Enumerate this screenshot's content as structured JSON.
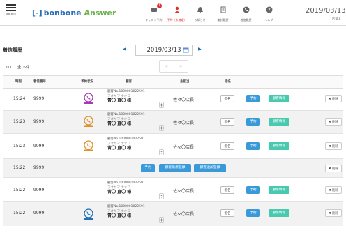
{
  "header": {
    "menu_label": "MENU",
    "logo_bracket": "[-]",
    "logo_brand": "bonbone",
    "logo_answer": "Answer",
    "nav": [
      {
        "label": "キャスト予約",
        "icon": "cast-icon",
        "badge": "1",
        "highlight": false
      },
      {
        "label": "予約（未確定）",
        "icon": "person-icon",
        "badge": "",
        "highlight": true
      },
      {
        "label": "お知らせ",
        "icon": "bell-icon",
        "badge": "",
        "highlight": false
      },
      {
        "label": "集計履歴",
        "icon": "doc-icon",
        "badge": "",
        "highlight": false
      },
      {
        "label": "着信履歴",
        "icon": "phone-icon",
        "badge": "",
        "highlight": false
      },
      {
        "label": "ヘルプ",
        "icon": "help-icon",
        "badge": "",
        "highlight": false
      }
    ],
    "date": "2019/03/13",
    "sub": "店舗1"
  },
  "page": {
    "title": "着信履歴",
    "date": "2019/03/13",
    "prev": "◀",
    "next": "▶",
    "page_info": "1/1",
    "total_label": "全",
    "total": "6件",
    "pager_prev": "«",
    "pager_next": "»"
  },
  "columns": [
    "時刻",
    "着信番号",
    "予約状況",
    "顧客",
    "主担当",
    "指名"
  ],
  "actions": {
    "nominate": "指名",
    "reserve": "予約",
    "customer_info": "顧客情報",
    "delete": "✖ 削除",
    "new_customer": "顧客新規登録",
    "add_customer": "顧客追加登録"
  },
  "rows": [
    {
      "type": "full",
      "time": "15:24",
      "number": "9999",
      "status_color": "#a63cb5",
      "cust_no": "顧客No.1000001022591",
      "cust_kana": "アオヤマ ナオコ",
      "cust_name": "青〇 直〇 様",
      "staff": "佐々〇店長"
    },
    {
      "type": "full",
      "time": "15:23",
      "number": "9999",
      "status_color": "#e0902a",
      "cust_no": "顧客No.1000001022591",
      "cust_kana": "アオヤマ ナオコ",
      "cust_name": "青〇 直〇 様",
      "staff": "佐々〇店長"
    },
    {
      "type": "full",
      "time": "15:23",
      "number": "9999",
      "status_color": "#e0902a",
      "cust_no": "顧客No.1000001022591",
      "cust_kana": "アオヤマ ナオコ",
      "cust_name": "青〇 直〇 様",
      "staff": "佐々〇店長"
    },
    {
      "type": "bar",
      "time": "15:22",
      "number": "9999"
    },
    {
      "type": "full",
      "time": "15:22",
      "number": "9999",
      "status_color": "",
      "cust_no": "顧客No.1000001022591",
      "cust_kana": "アオヤマ ナオコ",
      "cust_name": "青〇 直〇 様",
      "staff": "佐々〇店長"
    },
    {
      "type": "full",
      "time": "15:22",
      "number": "9999",
      "status_color": "#1e6fb6",
      "cust_no": "顧客No.1000001022591",
      "cust_kana": "アオヤマ ナオコ",
      "cust_name": "青〇 直〇 様",
      "staff": "佐々〇店長"
    }
  ]
}
